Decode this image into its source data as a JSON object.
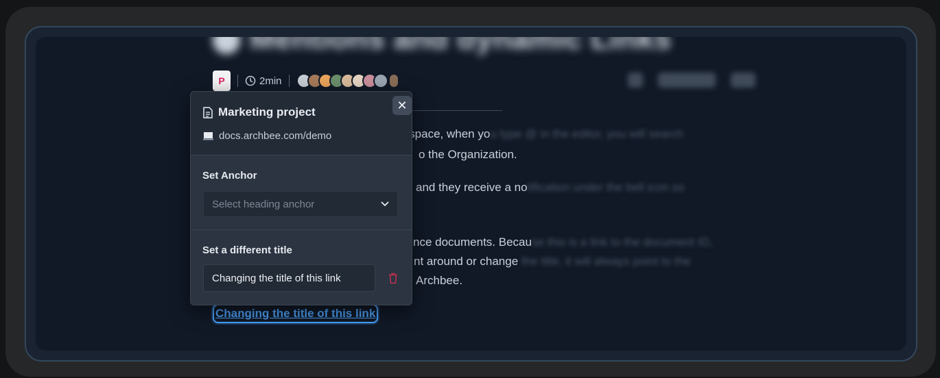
{
  "page": {
    "title": "Mentions and dynamic Links",
    "space_badge": "P",
    "read_time": "2min",
    "avatar_colors": [
      "#c7cdd4",
      "#a57a5a",
      "#e9a35b",
      "#6b8e6b",
      "#d7b99a",
      "#e5d3c2",
      "#c98e9a",
      "#9aa5b1"
    ],
    "paragraphs": [
      {
        "visible": "a space, when yo",
        "faded": "u type @ in the editor, you will search"
      },
      {
        "visible": "o the Organization.",
        "faded": ""
      },
      {
        "visible": "and they receive a no",
        "faded": "tification under the bell icon so"
      },
      {
        "visible": "nce documents. Becau",
        "faded": "se this is a link to the document ID,"
      },
      {
        "visible": "nt around or change",
        "faded": " the title, it will always point to the"
      },
      {
        "visible": "Archbee.",
        "faded": ""
      }
    ],
    "link_text": "Changing the title of this link"
  },
  "popover": {
    "doc_title": "Marketing project",
    "url": "docs.archbee.com/demo",
    "close_label": "✕",
    "anchor_section_title": "Set Anchor",
    "anchor_placeholder": "Select heading anchor",
    "title_section_title": "Set a different title",
    "title_value": "Changing the title of this link"
  },
  "colors": {
    "accent_link": "#4a9cf0",
    "badge_text": "#d8255d",
    "delete": "#c0304f"
  },
  "icons": [
    "clock-icon",
    "document-icon",
    "url-icon",
    "close-icon",
    "chevron-down-icon",
    "trash-icon"
  ]
}
